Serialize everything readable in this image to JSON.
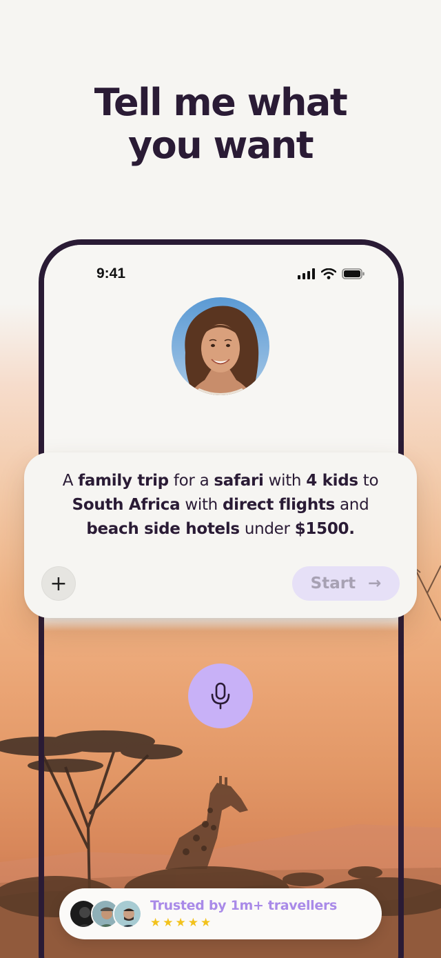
{
  "headline": {
    "line1": "Tell me what",
    "line2": "you want"
  },
  "status_bar": {
    "time": "9:41",
    "icons": [
      "cellular-signal-icon",
      "wifi-icon",
      "battery-icon"
    ]
  },
  "prompt": {
    "segments": [
      {
        "text": "A ",
        "bold": false
      },
      {
        "text": "family trip",
        "bold": true
      },
      {
        "text": " for a ",
        "bold": false
      },
      {
        "text": "safari",
        "bold": true
      },
      {
        "text": " with ",
        "bold": false
      },
      {
        "text": "4 kids",
        "bold": true
      },
      {
        "text": " to ",
        "bold": false
      },
      {
        "text": "South Africa",
        "bold": true
      },
      {
        "text": " with ",
        "bold": false
      },
      {
        "text": "direct flights",
        "bold": true
      },
      {
        "text": " and ",
        "bold": false
      },
      {
        "text": "beach side hotels",
        "bold": true
      },
      {
        "text": " under ",
        "bold": false
      },
      {
        "text": "$1500.",
        "bold": true
      }
    ],
    "add_label": "+",
    "start_label": "Start",
    "start_arrow": "→"
  },
  "mic": {
    "icon": "microphone-icon"
  },
  "trust": {
    "text": "Trusted by 1m+ travellers",
    "stars": "★★★★★",
    "rating": 5
  },
  "colors": {
    "ink": "#2a1b35",
    "accent_purple": "#c8b1f7",
    "trust_text": "#a98ae8",
    "star": "#f2c21c",
    "start_bg": "#e6e0f7"
  }
}
